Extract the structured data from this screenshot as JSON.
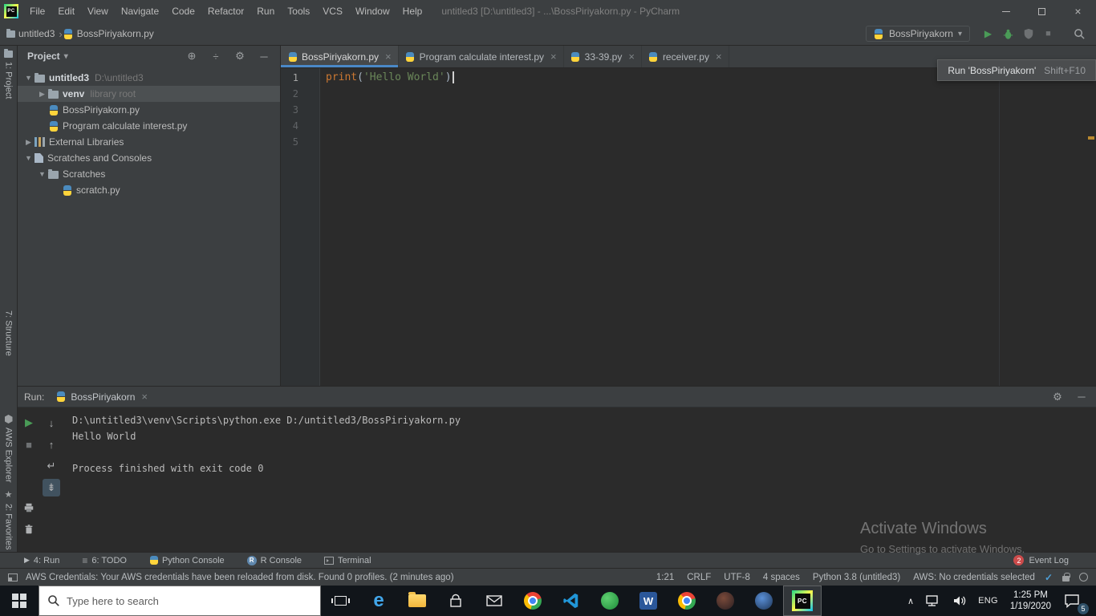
{
  "icons": {
    "gear": "⚙",
    "minimize": "─",
    "caret_down": "▾",
    "chevron": "›",
    "locate": "⊕",
    "collapse_all": "÷",
    "play": "▶",
    "stop": "■",
    "close": "×",
    "arrow_down": "↓",
    "arrow_up": "↑",
    "soft_wrap": "↵",
    "scroll_end": "⇟",
    "todo": "≡",
    "star": "★",
    "chevron_up": "∧",
    "check": "✓",
    "r": "R",
    "word": "W",
    "edge": "e"
  },
  "titlebar": {
    "menus": [
      "File",
      "Edit",
      "View",
      "Navigate",
      "Code",
      "Refactor",
      "Run",
      "Tools",
      "VCS",
      "Window",
      "Help"
    ],
    "title": "untitled3 [D:\\untitled3] - ...\\BossPiriyakorn.py - PyCharm"
  },
  "toolbar": {
    "crumb_project": "untitled3",
    "crumb_file": "BossPiriyakorn.py",
    "run_config": "BossPiriyakorn"
  },
  "stripe": {
    "project": "1: Project",
    "structure": "7: Structure",
    "aws": "AWS Explorer",
    "favorites": "2: Favorites"
  },
  "project": {
    "title": "Project",
    "items": [
      {
        "arrow": "▼",
        "name": "untitled3",
        "hint": "D:\\untitled3"
      },
      {
        "arrow": "▶",
        "name": "venv",
        "hint": "library root"
      },
      {
        "arrow": "",
        "name": "BossPiriyakorn.py",
        "hint": ""
      },
      {
        "arrow": "",
        "name": "Program calculate interest.py",
        "hint": ""
      },
      {
        "arrow": "▶",
        "name": "External Libraries",
        "hint": ""
      },
      {
        "arrow": "▼",
        "name": "Scratches and Consoles",
        "hint": ""
      },
      {
        "arrow": "▼",
        "name": "Scratches",
        "hint": ""
      },
      {
        "arrow": "",
        "name": "scratch.py",
        "hint": ""
      }
    ]
  },
  "editor": {
    "tabs": [
      {
        "label": "BossPiriyakorn.py"
      },
      {
        "label": "Program calculate interest.py"
      },
      {
        "label": "33-39.py"
      },
      {
        "label": "receiver.py"
      }
    ],
    "lines": [
      "1",
      "2",
      "3",
      "4",
      "5"
    ],
    "code": {
      "func": "print",
      "open": "(",
      "str": "'Hello World'",
      "close": ")"
    },
    "tooltip": {
      "text": "Run 'BossPiriyakorn'",
      "shortcut": "Shift+F10"
    }
  },
  "run": {
    "label": "Run:",
    "tab": "BossPiriyakorn",
    "output": [
      "D:\\untitled3\\venv\\Scripts\\python.exe D:/untitled3/BossPiriyakorn.py",
      "Hello World",
      "",
      "Process finished with exit code 0"
    ]
  },
  "watermark": {
    "line1": "Activate Windows",
    "line2": "Go to Settings to activate Windows."
  },
  "bottombar": {
    "items": [
      "4: Run",
      "6: TODO",
      "Python Console",
      "R Console",
      "Terminal"
    ],
    "event_log": "Event Log",
    "event_badge": "2"
  },
  "statusbar": {
    "message": "AWS Credentials: Your AWS credentials have been reloaded from disk. Found 0 profiles. (2 minutes ago)",
    "items": [
      "1:21",
      "CRLF",
      "UTF-8",
      "4 spaces",
      "Python 3.8 (untitled3)",
      "AWS: No credentials selected"
    ]
  },
  "taskbar": {
    "search_placeholder": "Type here to search",
    "lang": "ENG",
    "time": "1:25 PM",
    "date": "1/19/2020",
    "badge": "5"
  }
}
